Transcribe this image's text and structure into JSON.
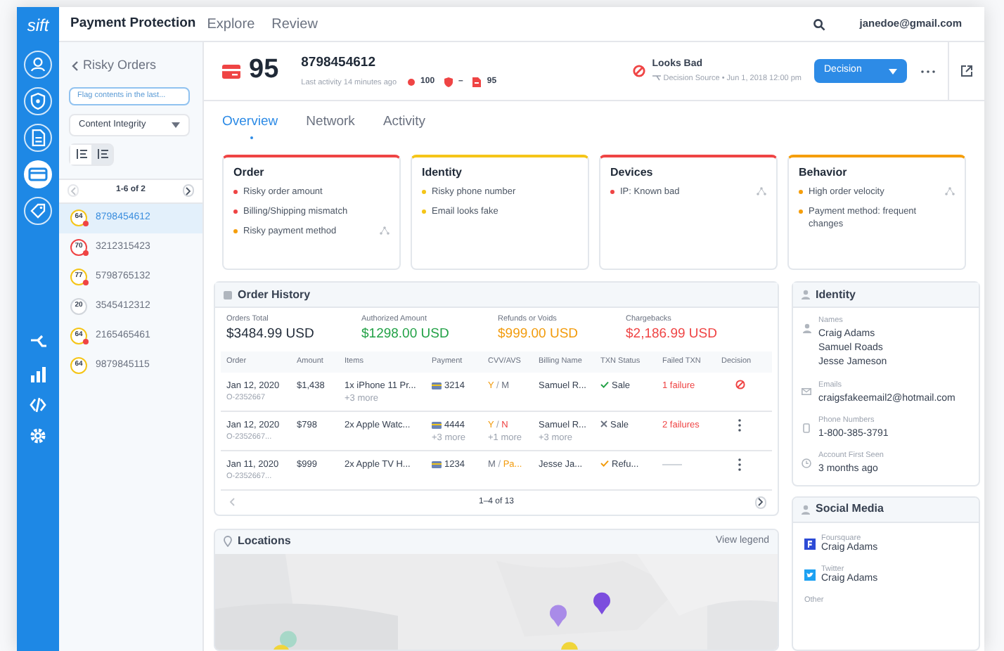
{
  "app": {
    "logo": "sift",
    "title": "Payment Protection",
    "nav": [
      "Explore",
      "Review"
    ],
    "user": "janedoe@gmail.com"
  },
  "rail": [
    {
      "selected": false
    },
    {
      "selected": false
    },
    {
      "selected": false
    },
    {
      "selected": true
    },
    {
      "selected": false
    }
  ],
  "sidebar": {
    "back": "Risky Orders",
    "filter_placeholder": "Flag contents in the last...",
    "dropdown": "Content Integrity",
    "views": [
      {
        "selected": false
      },
      {
        "selected": true
      }
    ],
    "pager": "1-6 of 2",
    "orders": [
      {
        "score": "64",
        "color": "#f5c518",
        "flagged": true,
        "id": "8798454612",
        "selected": true
      },
      {
        "score": "70",
        "color": "#ef4444",
        "flagged": true,
        "id": "3212315423",
        "selected": false
      },
      {
        "score": "77",
        "color": "#f5c518",
        "flagged": true,
        "id": "5798765132",
        "selected": false
      },
      {
        "score": "20",
        "color": "#d1d5db",
        "flagged": false,
        "id": "3545412312",
        "selected": false
      },
      {
        "score": "64",
        "color": "#f5c518",
        "flagged": true,
        "id": "2165465461",
        "selected": false
      },
      {
        "score": "64",
        "color": "#f5c518",
        "flagged": false,
        "id": "9879845115",
        "selected": false
      }
    ]
  },
  "header": {
    "score": "95",
    "order_id": "8798454612",
    "last_activity": "Last activity 14 minutes ago",
    "signals": [
      {
        "kind": "dot",
        "text": "100"
      },
      {
        "kind": "shield",
        "text": "–"
      },
      {
        "kind": "doc",
        "text": "95"
      }
    ],
    "verdict": {
      "label": "Looks Bad",
      "source": "Decision Source • Jun 1, 2018 12:00 pm"
    },
    "decision_button": "Decision"
  },
  "tabs": [
    {
      "label": "Overview",
      "selected": true
    },
    {
      "label": "Network",
      "selected": false
    },
    {
      "label": "Activity",
      "selected": false
    }
  ],
  "signal_cards": [
    {
      "title": "Order",
      "color": "#ef4444",
      "linked": true,
      "items": [
        {
          "text": "Risky order amount",
          "color": "#ef4444"
        },
        {
          "text": "Billing/Shipping mismatch",
          "color": "#ef4444"
        },
        {
          "text": "Risky payment method",
          "color": "#f59e0b"
        }
      ]
    },
    {
      "title": "Identity",
      "color": "#f5c518",
      "linked": false,
      "items": [
        {
          "text": "Risky phone number",
          "color": "#f5c518"
        },
        {
          "text": "Email looks fake",
          "color": "#f5c518"
        }
      ]
    },
    {
      "title": "Devices",
      "color": "#ef4444",
      "linked": true,
      "items": [
        {
          "text": "IP: Known bad",
          "color": "#ef4444"
        }
      ]
    },
    {
      "title": "Behavior",
      "color": "#f59e0b",
      "linked": true,
      "items": [
        {
          "text": "High order velocity",
          "color": "#f59e0b"
        },
        {
          "text": "Payment method: frequent changes",
          "color": "#f59e0b"
        }
      ]
    }
  ],
  "order_history": {
    "title": "Order History",
    "totals": [
      {
        "label": "Orders Total",
        "value": "$3484.99 USD",
        "color": "#1f2937"
      },
      {
        "label": "Authorized Amount",
        "value": "$1298.00 USD",
        "color": "#22a146"
      },
      {
        "label": "Refunds or Voids",
        "value": "$999.00 USD",
        "color": "#f29b0c"
      },
      {
        "label": "Chargebacks",
        "value": "$2,186.99 USD",
        "color": "#ef4444"
      }
    ],
    "columns": [
      "Order",
      "Amount",
      "Items",
      "Payment",
      "CVV/AVS",
      "Billing Name",
      "TXN Status",
      "Failed TXN",
      "Decision"
    ],
    "rows": [
      {
        "date": "Jan 12, 2020",
        "order": "O-2352667",
        "amount": "$1,438",
        "items": [
          "1x iPhone 11 Pr...",
          "+3 more"
        ],
        "payment": [
          "3214"
        ],
        "cvv": [
          {
            "text": "Y",
            "color": "#f29b0c"
          },
          {
            "text": " / "
          },
          {
            "text": "M",
            "color": "#6b7280"
          }
        ],
        "billing": [
          "Samuel R..."
        ],
        "status": {
          "kind": "check",
          "color": "#22a146",
          "text": "Sale"
        },
        "failed": "1 failure",
        "decision": {
          "kind": "blocked"
        }
      },
      {
        "date": "Jan 12, 2020",
        "order": "O-2352667...",
        "amount": "$798",
        "items": [
          "2x Apple Watc..."
        ],
        "payment": [
          "4444",
          "+3 more"
        ],
        "cvv": [
          {
            "text": "Y",
            "color": "#f29b0c"
          },
          {
            "text": " / "
          },
          {
            "text": "N",
            "color": "#ef4444"
          }
        ],
        "cvv_more": "+1 more",
        "billing": [
          "Samuel R...",
          "+3 more"
        ],
        "status": {
          "kind": "cross",
          "color": "#6b7280",
          "text": "Sale"
        },
        "failed": "2 failures",
        "decision": {
          "kind": "menu"
        }
      },
      {
        "date": "Jan 11, 2020",
        "order": "O-2352667...",
        "amount": "$999",
        "items": [
          "2x Apple TV H..."
        ],
        "payment": [
          "1234"
        ],
        "cvv": [
          {
            "text": "M",
            "color": "#6b7280"
          },
          {
            "text": " / "
          },
          {
            "text": "Pa...",
            "color": "#f29b0c"
          }
        ],
        "billing": [
          "Jesse Ja..."
        ],
        "status": {
          "kind": "check",
          "color": "#f29b0c",
          "text": "Refu..."
        },
        "decision": {
          "kind": "menu"
        }
      }
    ],
    "pager": "1–4 of 13"
  },
  "identity": {
    "title": "Identity",
    "fields": [
      {
        "kind": "person",
        "label": "Names",
        "values": [
          "Craig Adams",
          "Samuel Roads",
          "Jesse Jameson"
        ]
      },
      {
        "kind": "mail",
        "label": "Emails",
        "values": [
          "craigsfakeemail2@hotmail.com"
        ]
      },
      {
        "kind": "phone",
        "label": "Phone Numbers",
        "values": [
          "1-800-385-3791"
        ]
      },
      {
        "kind": "clock",
        "label": "Account First Seen",
        "values": [
          "3 months ago"
        ]
      }
    ]
  },
  "locations": {
    "title": "Locations",
    "legend_link": "View legend"
  },
  "social_media": {
    "title": "Social Media",
    "accounts": [
      {
        "kind": "foursquare",
        "network": "Foursquare",
        "name": "Craig Adams"
      },
      {
        "kind": "twitter",
        "network": "Twitter",
        "name": "Craig Adams"
      },
      {
        "kind": "other",
        "network": "Other"
      }
    ]
  }
}
